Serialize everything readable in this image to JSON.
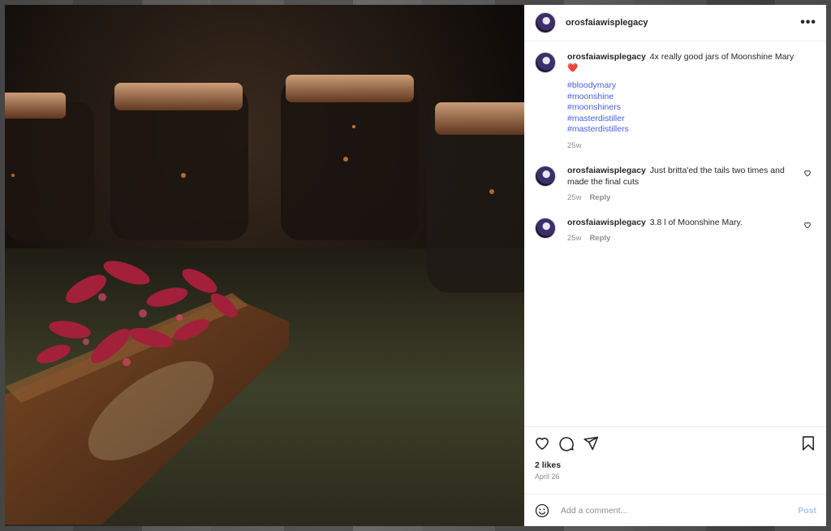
{
  "post": {
    "username": "orosfaiawisplegacy",
    "more_icon": "more-horizontal-icon",
    "comments": [
      {
        "username": "orosfaiawisplegacy",
        "text": "4x really good jars of Moonshine Mary",
        "emoji": "❤️",
        "hashtags": [
          "#bloodymary",
          "#moonshine",
          "#moonshiners",
          "#masterdistiller",
          "#masterdistillers"
        ],
        "time": "25w"
      },
      {
        "username": "orosfaiawisplegacy",
        "text": "Just britta'ed the tails two times and made the final cuts",
        "time": "25w",
        "reply_label": "Reply"
      },
      {
        "username": "orosfaiawisplegacy",
        "text": "3.8 l of Moonshine Mary.",
        "time": "25w",
        "reply_label": "Reply"
      }
    ],
    "actions": [
      "heart-icon",
      "comment-icon",
      "share-icon",
      "bookmark-icon"
    ],
    "likes": "2 likes",
    "date": "April 26",
    "add_comment": {
      "placeholder": "Add a comment...",
      "post_label": "Post"
    }
  },
  "colors": {
    "hashtag": "#4a5ce2",
    "post_button": "#a8c6f5",
    "muted": "#8e8e8e"
  }
}
